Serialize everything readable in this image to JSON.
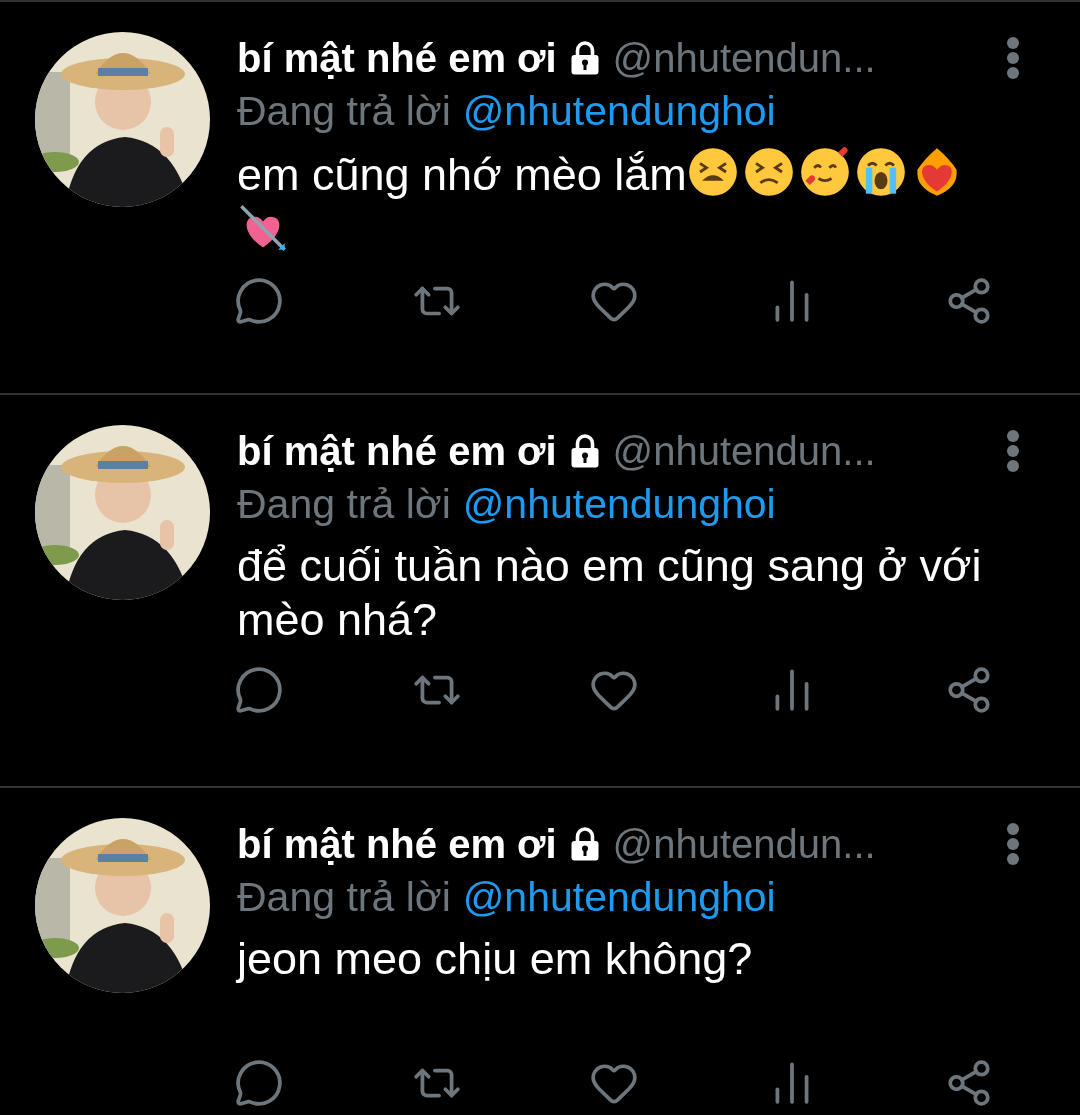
{
  "replies": [
    {
      "name": "bí mật nhé em ơi",
      "handle": "@nhutendun...",
      "replying_label": "Đang trả lời",
      "replying_to": "@nhutendunghoi",
      "text": "em cũng nhớ mèo lắm",
      "emojis": [
        {
          "kind": "tired"
        },
        {
          "kind": "persevering"
        },
        {
          "kind": "hearts"
        },
        {
          "kind": "crying"
        },
        {
          "kind": "fire-heart"
        },
        {
          "kind": "arrow-heart"
        }
      ]
    },
    {
      "name": "bí mật nhé em ơi",
      "handle": "@nhutendun...",
      "replying_label": "Đang trả lời",
      "replying_to": "@nhutendunghoi",
      "text": "để cuối tuần nào em cũng sang ở với mèo nhá?"
    },
    {
      "name": "bí mật nhé em ơi",
      "handle": "@nhutendun...",
      "replying_label": "Đang trả lời",
      "replying_to": "@nhutendunghoi",
      "text": "jeon meo chịu em không?"
    }
  ]
}
